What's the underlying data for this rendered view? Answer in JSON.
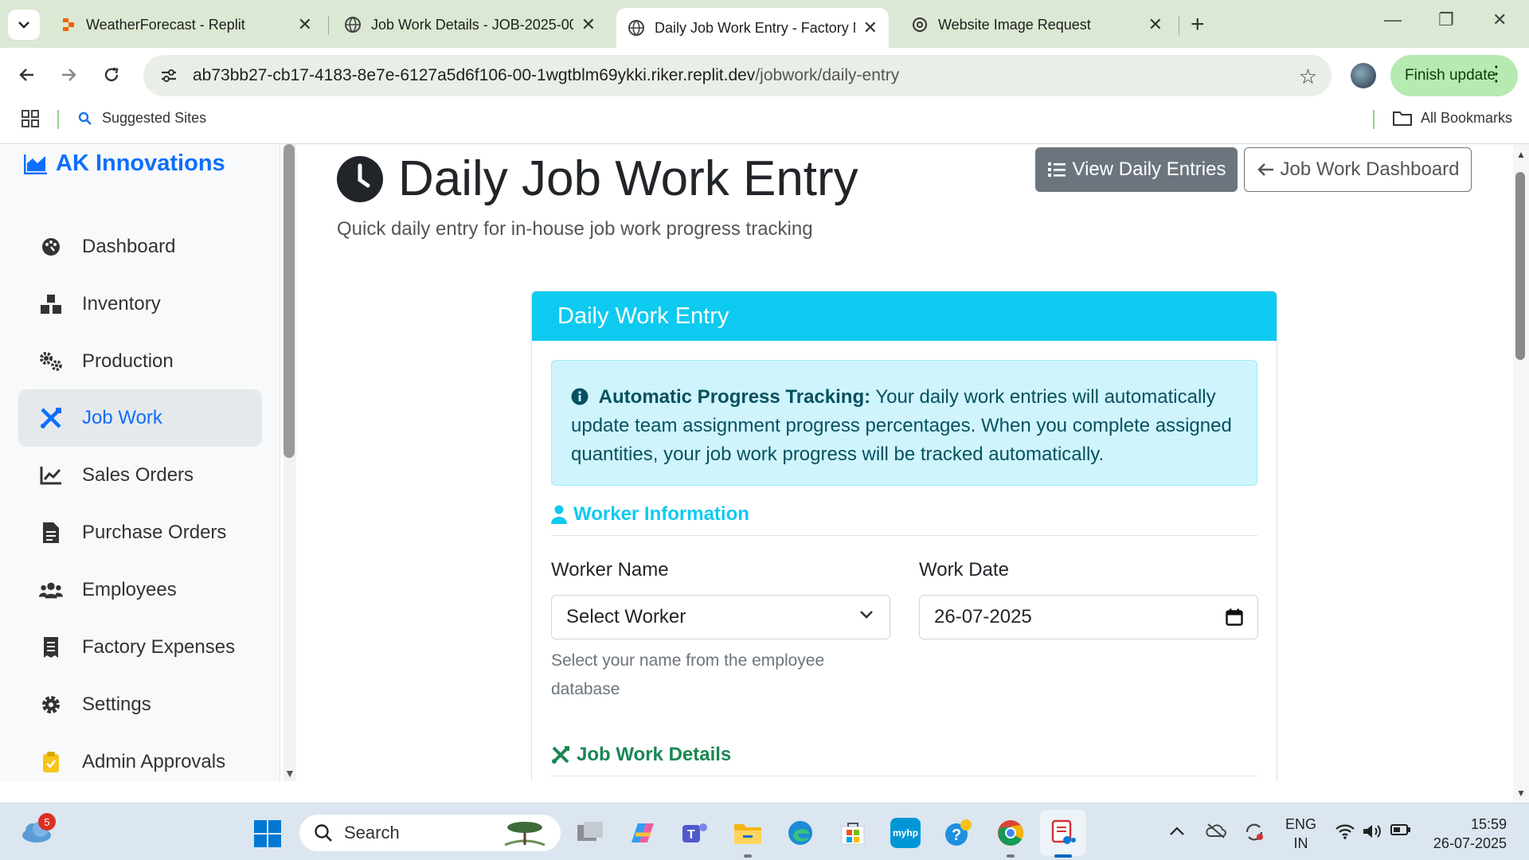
{
  "browser": {
    "tabs": [
      {
        "title": "WeatherForecast - Replit",
        "active": false
      },
      {
        "title": "Job Work Details - JOB-2025-00",
        "active": false
      },
      {
        "title": "Daily Job Work Entry - Factory M",
        "active": true
      },
      {
        "title": "Website Image Request",
        "active": false
      }
    ],
    "url_host": "ab73bb27-cb17-4183-8e7e-6127a5d6f106-00-1wgtblm69ykki.riker.replit.dev",
    "url_path": "/jobwork/daily-entry",
    "finish_update_label": "Finish update",
    "bookmarks": {
      "suggested": "Suggested Sites",
      "all": "All Bookmarks"
    }
  },
  "sidebar": {
    "brand": "AK Innovations",
    "items": [
      {
        "label": "Dashboard",
        "icon": "palette-icon",
        "active": false
      },
      {
        "label": "Inventory",
        "icon": "boxes-icon",
        "active": false
      },
      {
        "label": "Production",
        "icon": "cogs-icon",
        "active": false
      },
      {
        "label": "Job Work",
        "icon": "tools-icon",
        "active": true
      },
      {
        "label": "Sales Orders",
        "icon": "chart-line-icon",
        "active": false
      },
      {
        "label": "Purchase Orders",
        "icon": "file-icon",
        "active": false
      },
      {
        "label": "Employees",
        "icon": "users-icon",
        "active": false
      },
      {
        "label": "Factory Expenses",
        "icon": "receipt-icon",
        "active": false
      },
      {
        "label": "Settings",
        "icon": "gear-icon",
        "active": false
      },
      {
        "label": "Admin Approvals",
        "icon": "clipboard-icon",
        "active": false
      }
    ]
  },
  "page": {
    "title": "Daily Job Work Entry",
    "subtitle": "Quick daily entry for in-house job work progress tracking",
    "view_entries_label": "View Daily Entries",
    "dashboard_label": "Job Work Dashboard"
  },
  "card": {
    "header": "Daily Work Entry",
    "alert_strong": "Automatic Progress Tracking:",
    "alert_text": "Your daily work entries will automatically update team assignment progress percentages. When you complete assigned quantities, your job work progress will be tracked automatically.",
    "worker_section": "Worker Information",
    "worker_name_label": "Worker Name",
    "worker_select_value": "Select Worker",
    "worker_help": "Select your name from the employee database",
    "work_date_label": "Work Date",
    "work_date_value": "26-07-2025",
    "job_section": "Job Work Details"
  },
  "taskbar": {
    "weather_badge": "5",
    "search_label": "Search",
    "lang_line1": "ENG",
    "lang_line2": "IN",
    "time": "15:59",
    "date": "26-07-2025"
  },
  "colors": {
    "primary": "#0d6efd",
    "info": "#0dcaf0",
    "success": "#198754",
    "secondary": "#6c757d"
  }
}
